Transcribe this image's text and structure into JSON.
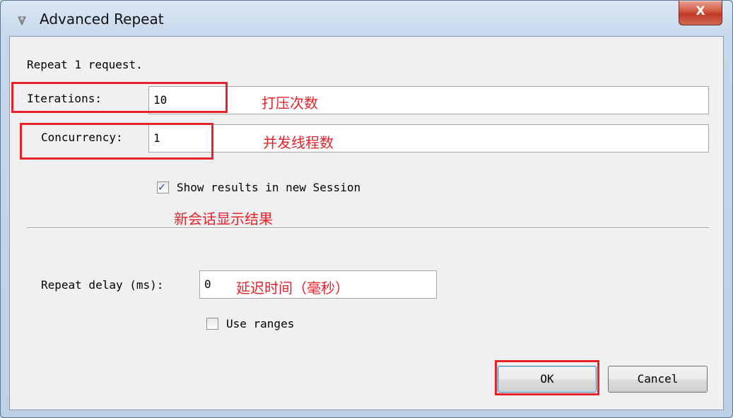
{
  "window": {
    "title": "Advanced Repeat",
    "close_label": "X",
    "icon": "fiddler-app-icon"
  },
  "header": {
    "summary": "Repeat 1 request."
  },
  "form": {
    "iterations": {
      "label": "Iterations:",
      "value": "10",
      "annotation": "打压次数"
    },
    "concurrency": {
      "label": "Concurrency:",
      "value": "1",
      "annotation": "并发线程数"
    },
    "show_results": {
      "label": "Show results in new Session",
      "checked": true,
      "annotation": "新会话显示结果"
    },
    "repeat_delay": {
      "label": "Repeat delay (ms):",
      "value": "0",
      "annotation": "延迟时间（毫秒）"
    },
    "use_ranges": {
      "label": "Use ranges",
      "checked": false
    }
  },
  "buttons": {
    "ok": "OK",
    "cancel": "Cancel"
  },
  "colors": {
    "annotation_red": "#e8222a",
    "title_bar": "#c6d8eb",
    "close_button": "#c23a25"
  }
}
